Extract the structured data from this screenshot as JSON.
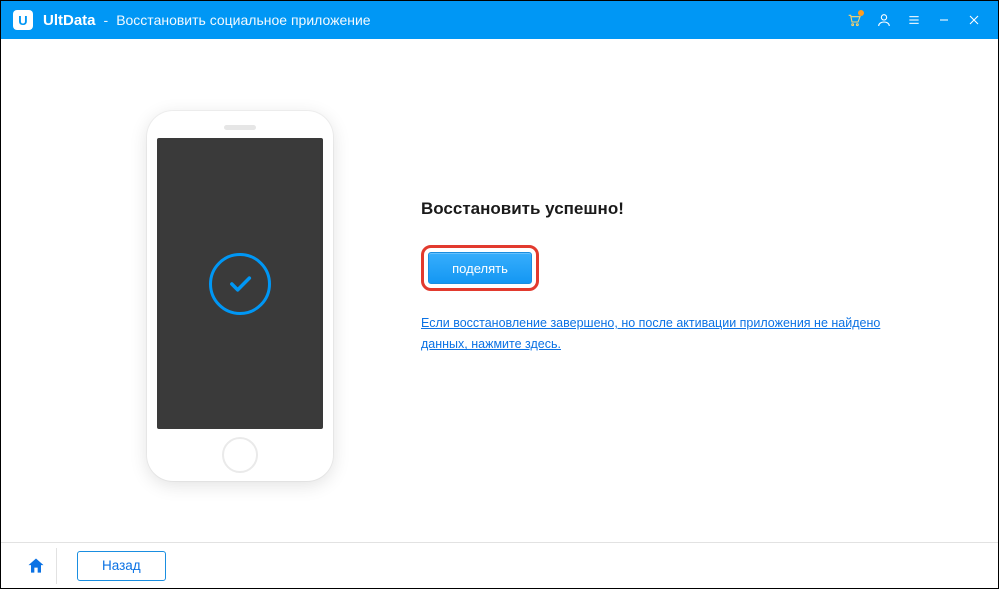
{
  "titlebar": {
    "app_name": "UltData",
    "separator": "-",
    "subtitle": "Восстановить социальное приложение"
  },
  "main": {
    "heading": "Восстановить успешно!",
    "share_label": "поделять",
    "help_link": "Если восстановление завершено, но после активации приложения не найдено данных, нажмите здесь."
  },
  "footer": {
    "back_label": "Назад"
  }
}
